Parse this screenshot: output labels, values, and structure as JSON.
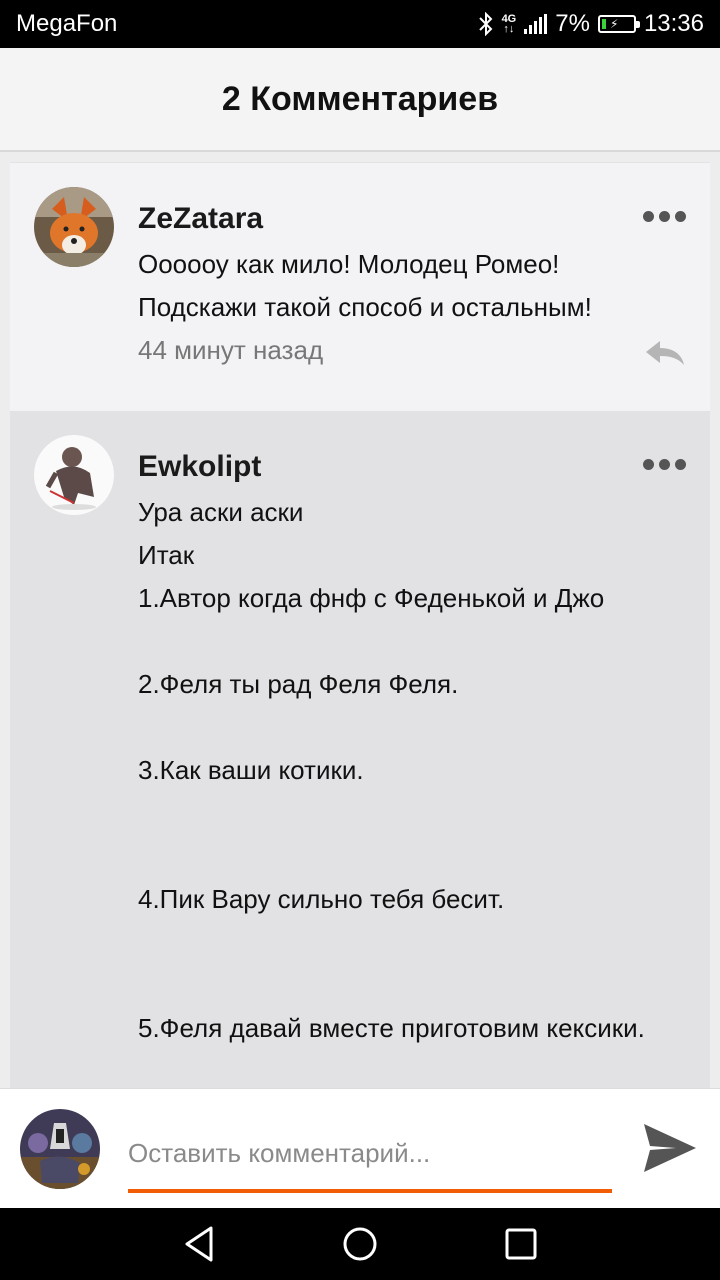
{
  "status_bar": {
    "carrier": "MegaFon",
    "network": "4G",
    "battery": "7%",
    "time": "13:36"
  },
  "header": {
    "title": "2 Комментариев"
  },
  "comments": [
    {
      "author": "ZeZatara",
      "text": "Оооооу как мило! Молодец Ромео!\nПодскажи такой способ и остальным!",
      "time": "44 минут назад"
    },
    {
      "author": "Ewkolipt",
      "text": "Ура аски аски\nИтак\n1.Автор когда фнф с Феденькой и Джо\n\n2.Феля ты рад Феля Феля.\n\n3.Как ваши котики.\n\n\n4.Пик Вару сильно тебя бесит.\n\n\n5.Феля давай вместе приготовим кексики."
    }
  ],
  "input": {
    "placeholder": "Оставить комментарий..."
  },
  "colors": {
    "accent": "#f25c05",
    "header_bg": "#f4f4f4"
  }
}
